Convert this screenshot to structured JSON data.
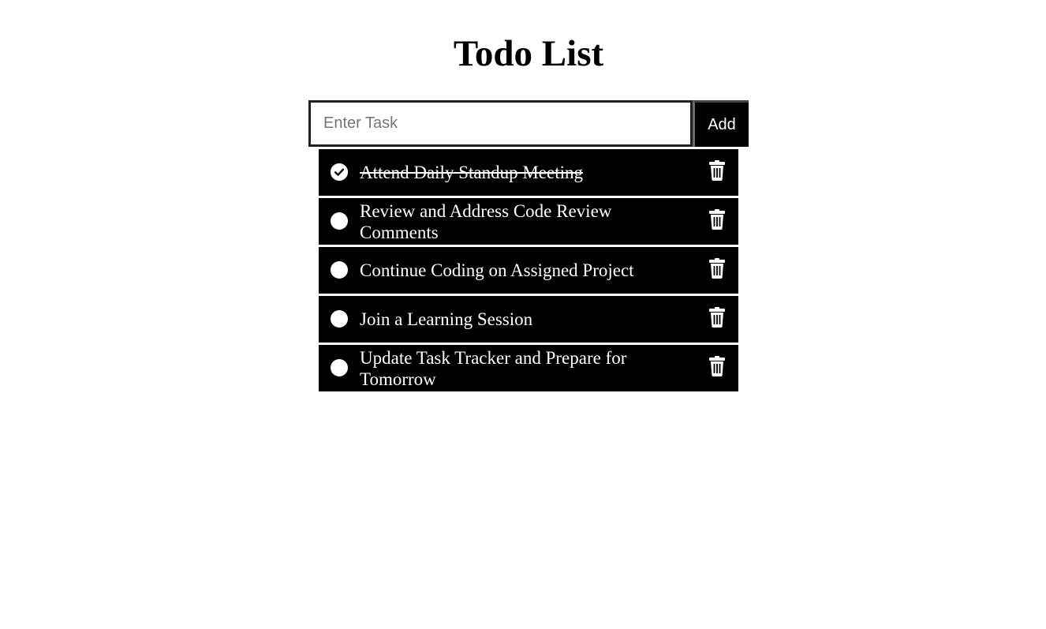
{
  "app": {
    "title": "Todo List"
  },
  "input": {
    "placeholder": "Enter Task",
    "value": "",
    "add_label": "Add"
  },
  "tasks": [
    {
      "label": "Attend Daily Standup Meeting",
      "completed": true
    },
    {
      "label": "Review and Address Code Review Comments",
      "completed": false
    },
    {
      "label": "Continue Coding on Assigned Project",
      "completed": false
    },
    {
      "label": "Join a Learning Session",
      "completed": false
    },
    {
      "label": "Update Task Tracker and Prepare for Tomorrow",
      "completed": false
    }
  ],
  "icons": {
    "check": "check-circle-icon",
    "unchecked": "circle-icon",
    "delete": "trash-icon"
  },
  "colors": {
    "item_background": "#000000",
    "item_text": "#ffffff",
    "page_background": "#ffffff"
  }
}
